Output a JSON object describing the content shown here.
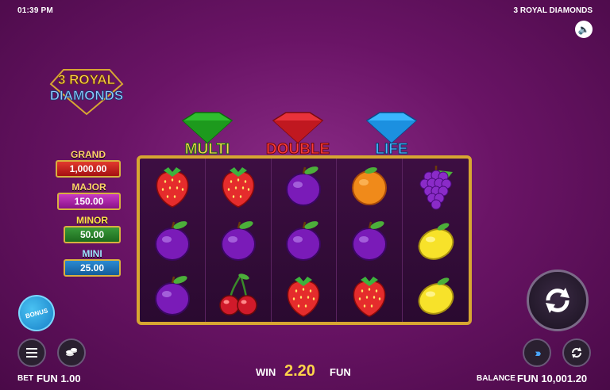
{
  "status": {
    "time": "01:39 PM",
    "game_title": "3 ROYAL DIAMONDS"
  },
  "logo": {
    "line1": "3 ROYAL",
    "line2": "DIAMONDS"
  },
  "features": {
    "multi": "MULTI",
    "double": "DOUBLE",
    "life": "LIFE"
  },
  "jackpots": {
    "grand": {
      "label": "GRAND",
      "value": "1,000.00"
    },
    "major": {
      "label": "MAJOR",
      "value": "150.00"
    },
    "minor": {
      "label": "MINOR",
      "value": "50.00"
    },
    "mini": {
      "label": "MINI",
      "value": "25.00"
    }
  },
  "reels": [
    [
      "strawberry",
      "strawberry",
      "plum",
      "orange",
      "grapes"
    ],
    [
      "plum",
      "plum",
      "plum",
      "plum",
      "lemon"
    ],
    [
      "plum",
      "cherry",
      "strawberry",
      "strawberry",
      "lemon"
    ]
  ],
  "buttons": {
    "bonus": "BONUS"
  },
  "footer": {
    "bet_label": "BET",
    "bet_value": "FUN 1.00",
    "win_label": "WIN",
    "win_value": "2.20",
    "win_currency": "FUN",
    "balance_label": "BALANCE",
    "balance_value": "FUN 10,001.20"
  },
  "icons": [
    "speaker-icon",
    "menu-icon",
    "coins-icon",
    "turbo-icon",
    "autoplay-icon",
    "spin-icon"
  ],
  "colors": {
    "background": "#6a1466",
    "reel_frame": "#d7a632",
    "win_value": "#ffd44a"
  }
}
